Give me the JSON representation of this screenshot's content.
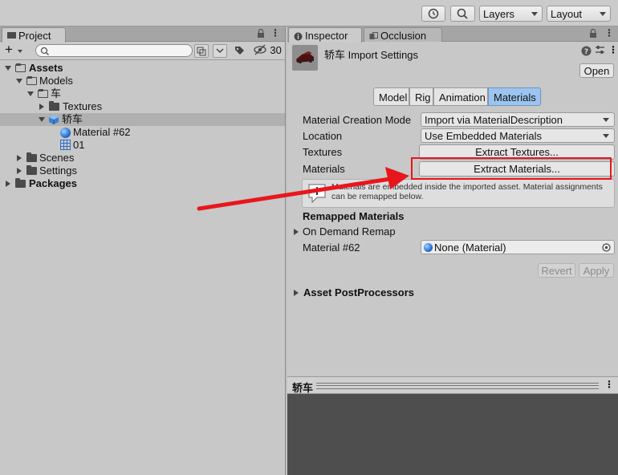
{
  "toolbar": {
    "layers_label": "Layers",
    "layout_label": "Layout"
  },
  "project": {
    "tab_label": "Project",
    "add_label": "+",
    "hidden_count": "30",
    "tree": [
      {
        "label": "Assets"
      },
      {
        "label": "Models"
      },
      {
        "label": "车"
      },
      {
        "label": "Textures"
      },
      {
        "label": "轿车"
      },
      {
        "label": "Material #62"
      },
      {
        "label": "01"
      },
      {
        "label": "Scenes"
      },
      {
        "label": "Settings"
      },
      {
        "label": "Packages"
      }
    ]
  },
  "inspector": {
    "tabs": [
      {
        "label": "Inspector"
      },
      {
        "label": "Occlusion"
      }
    ],
    "title": "轿车 Import Settings",
    "open_label": "Open",
    "segments": [
      {
        "label": "Model"
      },
      {
        "label": "Rig"
      },
      {
        "label": "Animation"
      },
      {
        "label": "Materials"
      }
    ],
    "material_creation_mode_label": "Material Creation Mode",
    "material_creation_mode_value": "Import via MaterialDescription",
    "location_label": "Location",
    "location_value": "Use Embedded Materials",
    "textures_label": "Textures",
    "extract_textures_label": "Extract Textures...",
    "materials_label": "Materials",
    "extract_materials_label": "Extract Materials...",
    "help_text": "Materials are embedded inside the imported asset. Material assignments can be remapped below.",
    "remapped_header": "Remapped Materials",
    "on_demand_label": "On Demand Remap",
    "material62_label": "Material #62",
    "material62_value": "None (Material)",
    "revert_label": "Revert",
    "apply_label": "Apply",
    "postprocessors_label": "Asset PostProcessors",
    "preview_title": "轿车"
  },
  "colors": {
    "annotation_red": "#e8161c",
    "selected_segment": "#9cc4ef"
  }
}
